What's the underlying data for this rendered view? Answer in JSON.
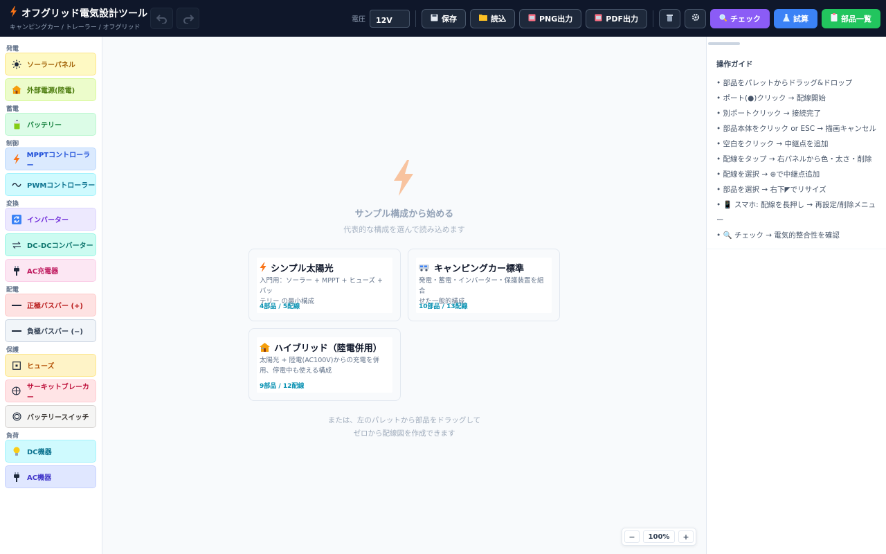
{
  "header": {
    "title": "オフグリッド電気設計ツール",
    "subtitle": "キャンピングカー / トレーラー / オフグリッド",
    "voltage_label": "電圧",
    "voltage_value": "12V",
    "save": "保存",
    "load": "読込",
    "png_export": "PNG出力",
    "pdf_export": "PDF出力",
    "check": "チェック",
    "calc": "試算",
    "parts_list": "部品一覧"
  },
  "palette": [
    {
      "category": "発電",
      "items": [
        {
          "label": "ソーラーパネル",
          "icon": "sun-icon",
          "bg": "#fef9c3",
          "border": "#fde68a",
          "color": "#a16207"
        },
        {
          "label": "外部電源(陸電)",
          "icon": "house-icon",
          "bg": "#ecfccb",
          "border": "#d9f99d",
          "color": "#4d7c0f"
        }
      ]
    },
    {
      "category": "蓄電",
      "items": [
        {
          "label": "バッテリー",
          "icon": "battery-icon",
          "bg": "#dcfce7",
          "border": "#bbf7d0",
          "color": "#15803d"
        }
      ]
    },
    {
      "category": "制御",
      "items": [
        {
          "label": "MPPTコントローラー",
          "icon": "bolt-icon",
          "bg": "#dbeafe",
          "border": "#bfdbfe",
          "color": "#1d4ed8"
        },
        {
          "label": "PWMコントローラー",
          "icon": "wave-icon",
          "bg": "#cffafe",
          "border": "#a5f3fc",
          "color": "#0e7490"
        }
      ]
    },
    {
      "category": "変換",
      "items": [
        {
          "label": "インバーター",
          "icon": "cycle-icon",
          "bg": "#ede9fe",
          "border": "#ddd6fe",
          "color": "#6d28d9"
        },
        {
          "label": "DC-DCコンバーター",
          "icon": "arrows-icon",
          "bg": "#ccfbf1",
          "border": "#99f6e4",
          "color": "#0f766e"
        },
        {
          "label": "AC充電器",
          "icon": "plug-icon",
          "bg": "#fce7f3",
          "border": "#fbcfe8",
          "color": "#be185d"
        }
      ]
    },
    {
      "category": "配電",
      "items": [
        {
          "label": "正極バスバー (+)",
          "icon": "bar-icon",
          "bg": "#fee2e2",
          "border": "#fecaca",
          "color": "#b91c1c"
        },
        {
          "label": "負極バスバー (−)",
          "icon": "bar-icon",
          "bg": "#f1f5f9",
          "border": "#cbd5e1",
          "color": "#334155"
        }
      ]
    },
    {
      "category": "保護",
      "items": [
        {
          "label": "ヒューズ",
          "icon": "fuse-icon",
          "bg": "#fef3c7",
          "border": "#fde68a",
          "color": "#b45309"
        },
        {
          "label": "サーキットブレーカー",
          "icon": "breaker-icon",
          "bg": "#ffe4e6",
          "border": "#fecdd3",
          "color": "#be123c"
        },
        {
          "label": "バッテリースイッチ",
          "icon": "switch-icon",
          "bg": "#f5f5f4",
          "border": "#d6d3d1",
          "color": "#44403c"
        }
      ]
    },
    {
      "category": "負荷",
      "items": [
        {
          "label": "DC機器",
          "icon": "bulb-icon",
          "bg": "#cffafe",
          "border": "#a5f3fc",
          "color": "#0e7490"
        },
        {
          "label": "AC機器",
          "icon": "plug-icon",
          "bg": "#e0e7ff",
          "border": "#c7d2fe",
          "color": "#4338ca"
        }
      ]
    }
  ],
  "canvas": {
    "empty_title": "サンプル構成から始める",
    "empty_sub": "代表的な構成を選んで読み込めます",
    "samples": [
      {
        "title": "シンプル太陽光",
        "icon": "bolt-icon",
        "desc1": "入門用：ソーラー + MPPT + ヒューズ + バッ",
        "desc2": "テリー の最小構成",
        "meta": "4部品 / 5配線"
      },
      {
        "title": "キャンピングカー標準",
        "icon": "camper-icon",
        "desc1": "発電・蓄電・インバーター・保護装置を組合",
        "desc2": "せた一般的構成",
        "meta": "10部品 / 13配線"
      },
      {
        "title": "ハイブリッド（陸電併用）",
        "icon": "house-icon",
        "desc1": "太陽光 + 陸電(AC100V)からの充電を併",
        "desc2": "用、停電中も使える構成",
        "meta": "9部品 / 12配線"
      }
    ],
    "hint1": "または、左のパレットから部品をドラッグして",
    "hint2": "ゼロから配線図を作成できます",
    "zoom_out": "−",
    "zoom_value": "100%",
    "zoom_in": "+"
  },
  "guide": {
    "title": "操作ガイド",
    "items": [
      "• 部品をパレットからドラッグ&ドロップ",
      "• ポート(●)クリック → 配線開始",
      "• 別ポートクリック → 接続完了",
      "• 部品本体をクリック or ESC → 描画キャンセル",
      "• 空白をクリック → 中継点を追加",
      "• 配線をタップ → 右パネルから色・太さ・削除",
      "• 配線を選択 → ⊕で中継点追加",
      "• 部品を選択 → 右下◤でリサイズ",
      "• 📱 スマホ: 配線を長押し → 再設定/削除メニュ",
      "ー",
      "• 🔍 チェック → 電気的整合性を確認"
    ]
  }
}
